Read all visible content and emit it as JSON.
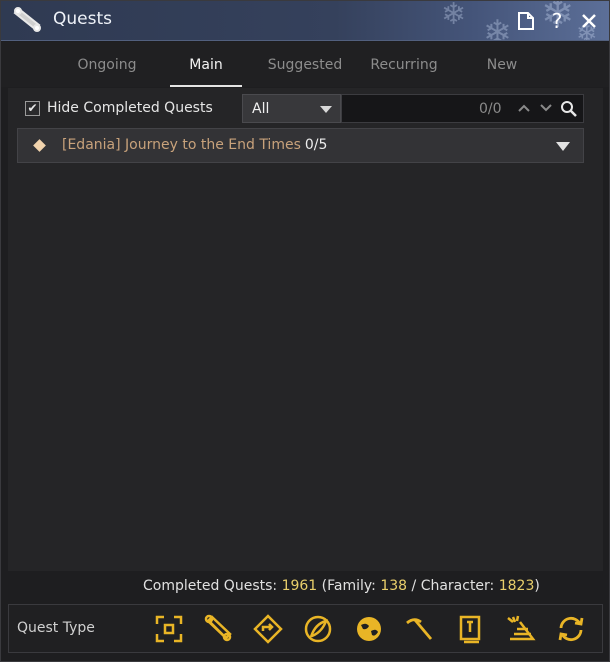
{
  "window": {
    "title": "Quests",
    "title_icon": "scroll-icon",
    "buttons": [
      {
        "name": "memo-button",
        "icon": "document-icon"
      },
      {
        "name": "help-button",
        "icon": "question-icon",
        "glyph": "?"
      },
      {
        "name": "close-button",
        "icon": "close-icon"
      }
    ]
  },
  "tabs": [
    {
      "label": "Ongoing",
      "active": false
    },
    {
      "label": "Main",
      "active": true
    },
    {
      "label": "Suggested",
      "active": false
    },
    {
      "label": "Recurring",
      "active": false
    },
    {
      "label": "New",
      "active": false
    }
  ],
  "filter": {
    "hide_completed_label": "Hide Completed Quests",
    "hide_completed_checked": true,
    "dropdown_value": "All",
    "search_count": "0/0"
  },
  "quests": [
    {
      "name": "[Edania] Journey to the End Times",
      "progress": "0/5"
    }
  ],
  "completed": {
    "label": "Completed Quests:",
    "total": "1961",
    "family_label": "(Family:",
    "family": "138",
    "sep": "/",
    "character_label": "Character:",
    "character": "1823",
    "close_paren": ")"
  },
  "quest_type": {
    "label": "Quest Type",
    "icons": [
      "focus-frame-icon",
      "scroll-icon",
      "diamond-arrow-icon",
      "feather-icon",
      "globe-icon",
      "pickaxe-icon",
      "book-icon",
      "cone-icon",
      "refresh-icon"
    ]
  },
  "colors": {
    "accent_gold": "#e9b526",
    "number_gold": "#e9cf6b",
    "quest_name": "#c8a27b",
    "titlebar": "#35415c"
  }
}
